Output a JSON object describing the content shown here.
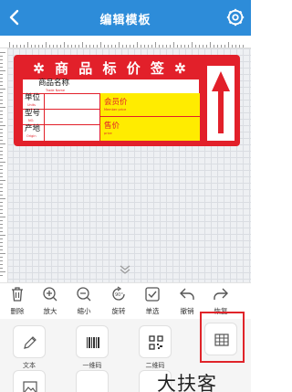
{
  "header": {
    "title": "编辑模板"
  },
  "label": {
    "banner_left_star": "✲",
    "banner_text": "商 品 标 价 签",
    "banner_right_star": "✲",
    "product_name_cn": "商品名称",
    "product_name_en": "Trade Name",
    "unit_cn": "单位",
    "unit_en": "Units",
    "model_cn": "型号",
    "model_en": "NO.",
    "origin_cn": "产地",
    "origin_en": "Origin",
    "member_price_cn": "会员价",
    "member_price_en": "Member price",
    "price_cn": "售价",
    "price_en": "price"
  },
  "toolbar": {
    "items": [
      {
        "label": "删除",
        "icon": "trash-icon"
      },
      {
        "label": "放大",
        "icon": "zoom-in-icon"
      },
      {
        "label": "缩小",
        "icon": "zoom-out-icon"
      },
      {
        "label": "旋转",
        "icon": "rotate-icon"
      },
      {
        "label": "单选",
        "icon": "check-square-icon"
      },
      {
        "label": "撤销",
        "icon": "undo-icon"
      },
      {
        "label": "恢复",
        "icon": "redo-icon"
      }
    ]
  },
  "palette": {
    "items": [
      {
        "label": "文本",
        "icon": "pen-icon"
      },
      {
        "label": "一维码",
        "icon": "barcode-icon"
      },
      {
        "label": "二维码",
        "icon": "qrcode-icon"
      },
      {
        "label": "",
        "icon": "table-icon"
      },
      {
        "label": "",
        "icon": "image-icon"
      }
    ]
  },
  "watermark": "大扶客",
  "colors": {
    "header": "#2d8cd9",
    "label_red": "#e2202a",
    "yellow": "#ffec00",
    "highlight": "#e0242a"
  }
}
